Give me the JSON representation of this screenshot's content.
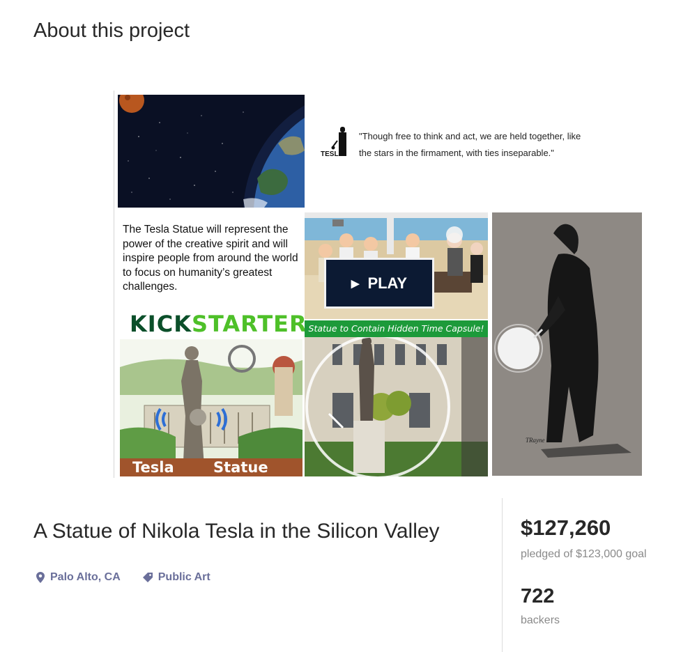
{
  "section": {
    "heading": "About this project"
  },
  "collage": {
    "quote": "\"Though free to think and act, we are held together, like the stars in the firmament, with ties inseparable.\"",
    "quote_line1": "\"Though free to think and act, we are held together, like",
    "quote_line2": "the stars in the firmament, with ties inseparable.\"",
    "tesla_logo_text": "TESLA",
    "description": "The Tesla Statue will represent the power of the creative spirit and will inspire people from around the world to focus on humanity’s greatest challenges.",
    "kickstarter_part1": "KICK",
    "kickstarter_part2": "STARTER",
    "statue_label_left": "Tesla",
    "statue_label_right": "Statue",
    "play_label": "PLAY",
    "capsule_banner": "Statue to Contain Hidden Time Capsule!",
    "sketch_signature": "TRayne"
  },
  "project": {
    "title": "A Statue of Nikola Tesla in the Silicon Valley",
    "location": "Palo Alto, CA",
    "category": "Public Art"
  },
  "stats": {
    "pledged": "$127,260",
    "goal_text": "pledged of $123,000 goal",
    "backers": "722",
    "backers_label": "backers"
  },
  "colors": {
    "meta_link": "#6a6f9a",
    "kick_dark": "#0b4f2a",
    "kick_green": "#4ec029",
    "banner_green": "#1d9a3a",
    "label_brown": "#a0542c"
  },
  "icons": {
    "location": "map-pin-icon",
    "category": "tag-icon",
    "play": "play-triangle-icon"
  }
}
